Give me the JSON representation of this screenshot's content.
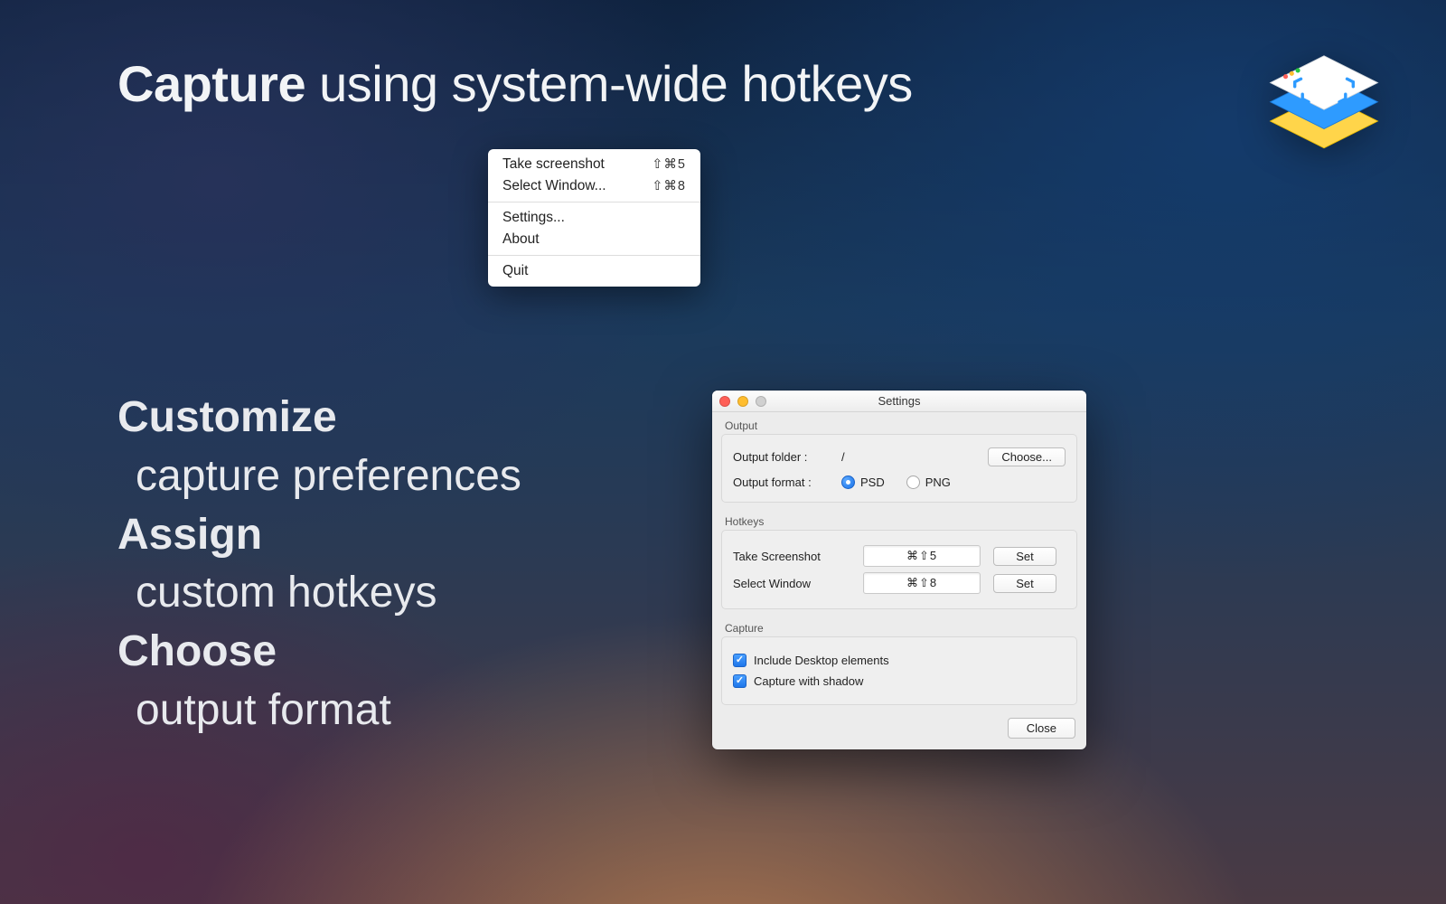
{
  "headline": {
    "strong": "Capture",
    "rest": " using system-wide hotkeys"
  },
  "features": [
    {
      "strong": "Customize",
      "sub": "capture preferences"
    },
    {
      "strong": "Assign",
      "sub": "custom hotkeys"
    },
    {
      "strong": "Choose",
      "sub": "output format"
    }
  ],
  "menu": {
    "items_a": [
      {
        "label": "Take screenshot",
        "shortcut": "⇧⌘5"
      },
      {
        "label": "Select Window...",
        "shortcut": "⇧⌘8"
      }
    ],
    "items_b": [
      {
        "label": "Settings..."
      },
      {
        "label": "About"
      }
    ],
    "items_c": [
      {
        "label": "Quit"
      }
    ]
  },
  "settings": {
    "title": "Settings",
    "output": {
      "section_label": "Output",
      "folder_label": "Output folder :",
      "folder_value": "/",
      "choose_label": "Choose...",
      "format_label": "Output format :",
      "format_psd": "PSD",
      "format_png": "PNG",
      "format_selected": "PSD"
    },
    "hotkeys": {
      "section_label": "Hotkeys",
      "rows": [
        {
          "label": "Take Screenshot",
          "value": "⌘⇧5",
          "set": "Set"
        },
        {
          "label": "Select Window",
          "value": "⌘⇧8",
          "set": "Set"
        }
      ]
    },
    "capture": {
      "section_label": "Capture",
      "include_desktop": "Include Desktop elements",
      "with_shadow": "Capture with shadow"
    },
    "close_label": "Close"
  }
}
